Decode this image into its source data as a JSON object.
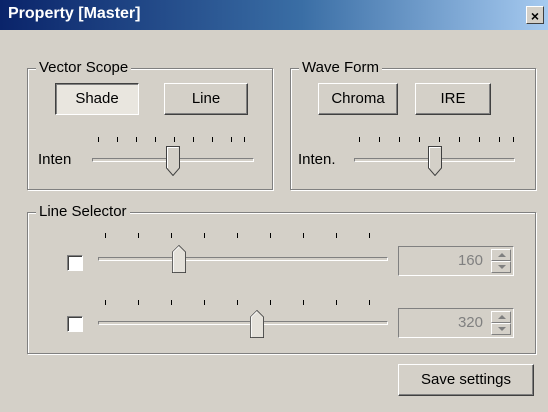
{
  "window": {
    "title": "Property [Master]",
    "close_glyph": "×"
  },
  "vector_scope": {
    "legend": "Vector Scope",
    "shade_label": "Shade",
    "line_label": "Line",
    "inten_label": "Inten",
    "intensity_level": 0.5
  },
  "wave_form": {
    "legend": "Wave Form",
    "chroma_label": "Chroma",
    "ire_label": "IRE",
    "inten_label": "Inten.",
    "intensity_level": 0.5
  },
  "line_selector": {
    "legend": "Line Selector",
    "rows": [
      {
        "checked": false,
        "value": "160",
        "slider_level": 0.29
      },
      {
        "checked": false,
        "value": "320",
        "slider_level": 0.57
      }
    ]
  },
  "footer": {
    "save_label": "Save settings"
  },
  "icons": [
    "close-icon",
    "spin-up-icon",
    "spin-down-icon"
  ]
}
